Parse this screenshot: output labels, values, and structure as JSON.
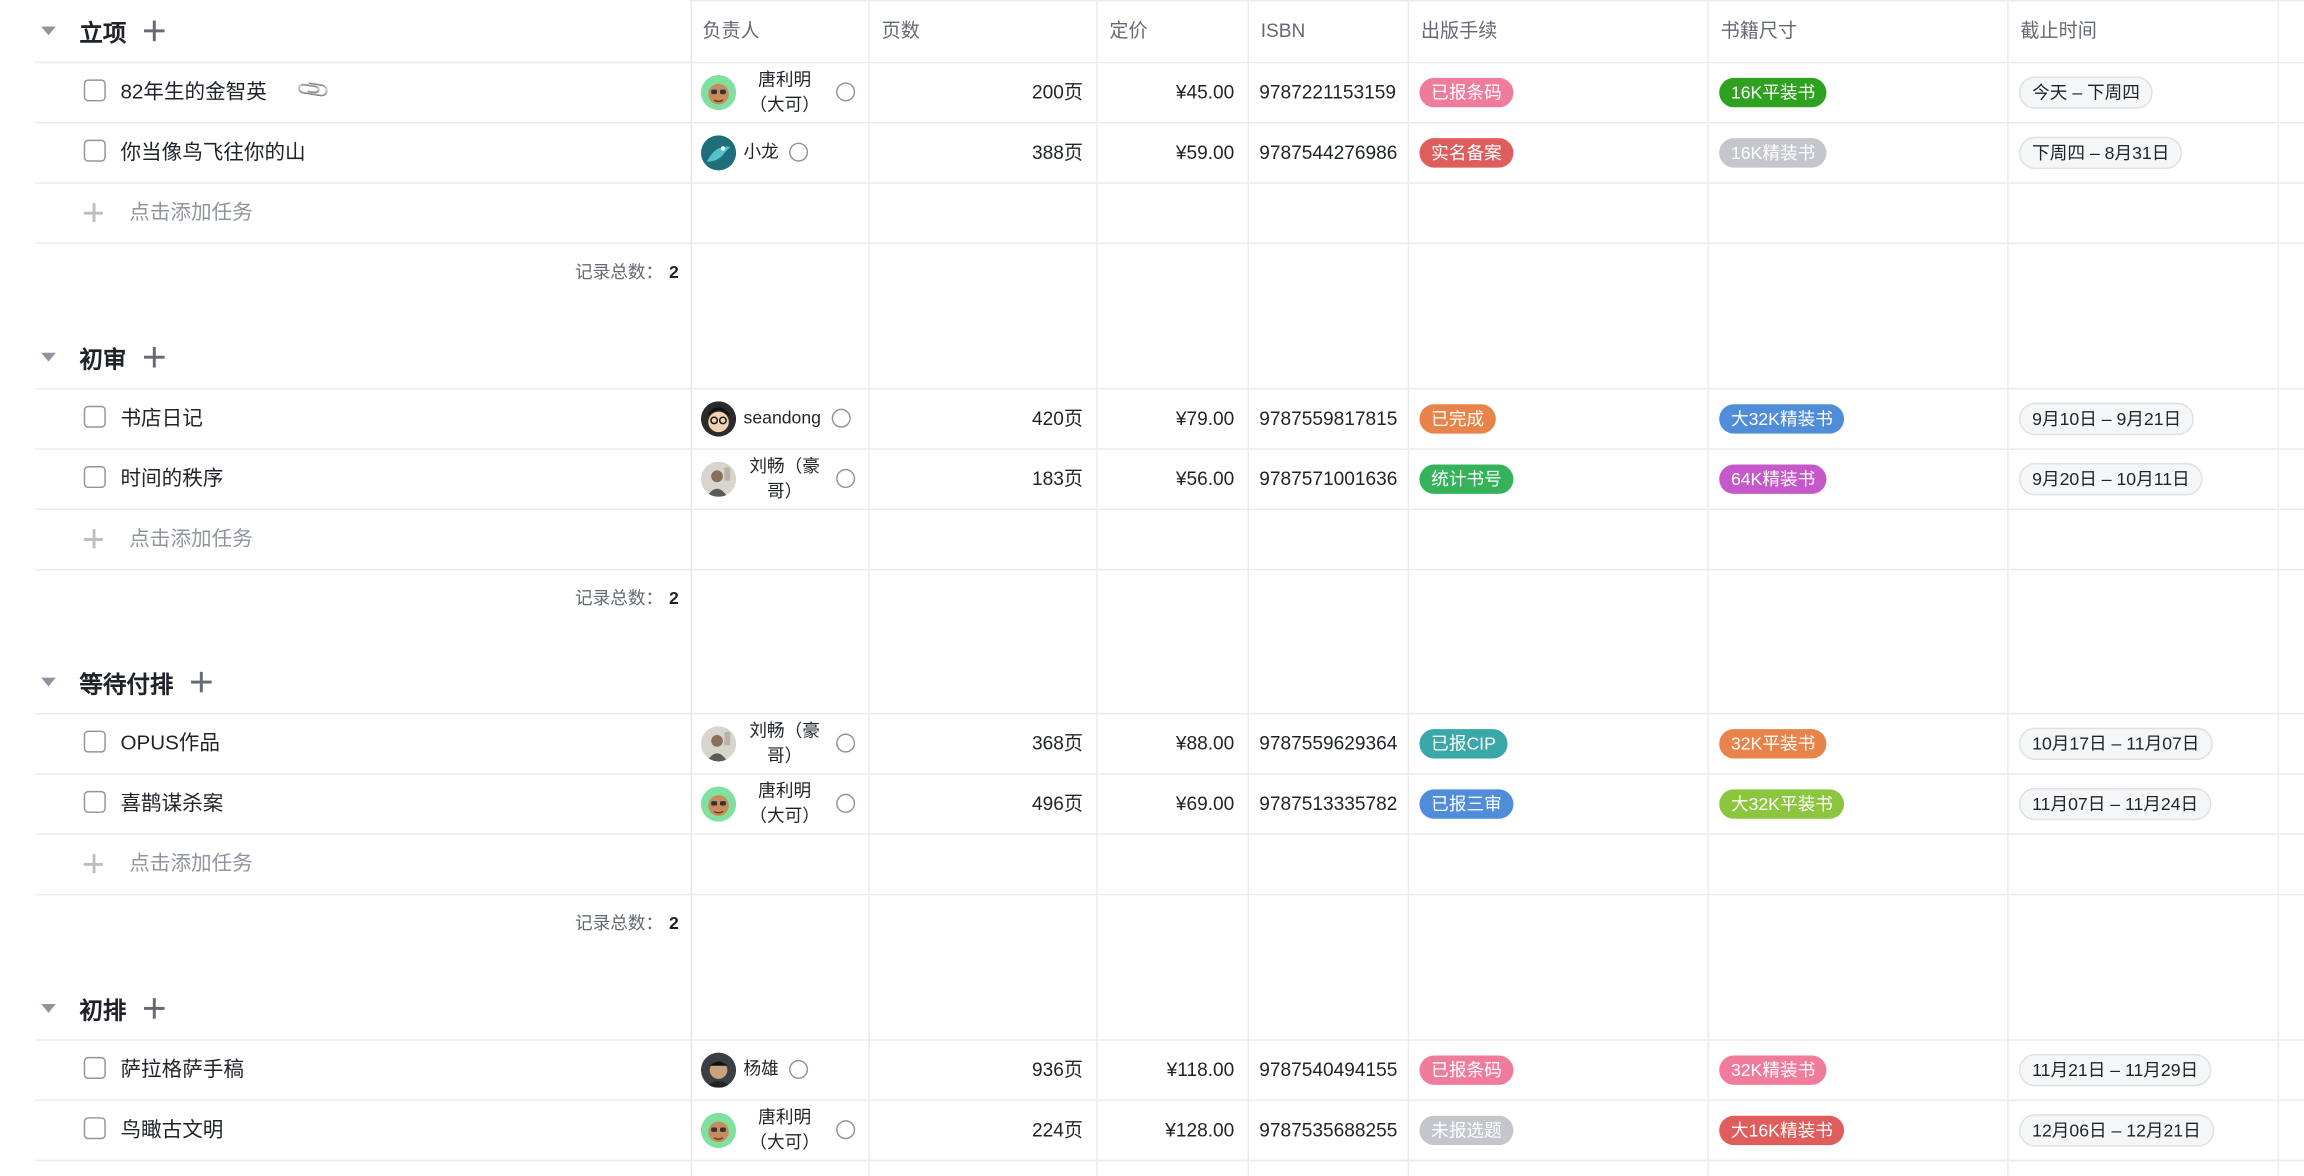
{
  "columns": {
    "owner": "负责人",
    "pages": "页数",
    "price": "定价",
    "isbn": "ISBN",
    "procedure": "出版手续",
    "size": "书籍尺寸",
    "deadline": "截止时间"
  },
  "add_task_label": "点击添加任务",
  "record_count_label": "记录总数：",
  "groups": [
    {
      "name": "立项",
      "count": "2",
      "tasks": [
        {
          "name": "82年生的金智英",
          "attachment": true,
          "owner": "唐利明（大可）",
          "owner_line1": "唐利明",
          "owner_line2": "（大可）",
          "avatar": "green-face",
          "pages": "200页",
          "price": "¥45.00",
          "isbn": "9787221153159",
          "procedure": "已报条码",
          "procedure_color": "#f07c9c",
          "size": "16K平装书",
          "size_color": "#2ea121",
          "deadline": "今天 – 下周四"
        },
        {
          "name": "你当像鸟飞往你的山",
          "owner": "小龙",
          "avatar": "teal-bird",
          "pages": "388页",
          "price": "¥59.00",
          "isbn": "9787544276986",
          "procedure": "实名备案",
          "procedure_color": "#e05d5d",
          "size": "16K精装书",
          "size_color": "#c4c6cc",
          "deadline": "下周四 – 8月31日"
        }
      ]
    },
    {
      "name": "初审",
      "count": "2",
      "tasks": [
        {
          "name": "书店日记",
          "owner": "seandong",
          "avatar": "dark-glasses",
          "pages": "420页",
          "price": "¥79.00",
          "isbn": "9787559817815",
          "procedure": "已完成",
          "procedure_color": "#e8844a",
          "size": "大32K精装书",
          "size_color": "#4f8ddb",
          "deadline": "9月10日 – 9月21日"
        },
        {
          "name": "时间的秩序",
          "owner": "刘畅（豪哥）",
          "owner_line1": "刘畅（豪",
          "owner_line2": "哥）",
          "avatar": "grey-man",
          "pages": "183页",
          "price": "¥56.00",
          "isbn": "9787571001636",
          "procedure": "统计书号",
          "procedure_color": "#34b35a",
          "size": "64K精装书",
          "size_color": "#c659c9",
          "deadline": "9月20日 – 10月11日"
        }
      ]
    },
    {
      "name": "等待付排",
      "count": "2",
      "tasks": [
        {
          "name": "OPUS作品",
          "owner": "刘畅（豪哥）",
          "owner_line1": "刘畅（豪",
          "owner_line2": "哥）",
          "avatar": "grey-man",
          "pages": "368页",
          "price": "¥88.00",
          "isbn": "9787559629364",
          "procedure": "已报CIP",
          "procedure_color": "#3aa8a8",
          "size": "32K平装书",
          "size_color": "#e8844a",
          "deadline": "10月17日 – 11月07日"
        },
        {
          "name": "喜鹊谋杀案",
          "owner": "唐利明（大可）",
          "owner_line1": "唐利明",
          "owner_line2": "（大可）",
          "avatar": "green-face",
          "pages": "496页",
          "price": "¥69.00",
          "isbn": "9787513335782",
          "procedure": "已报三审",
          "procedure_color": "#4f8ddb",
          "size": "大32K平装书",
          "size_color": "#8cc63f",
          "deadline": "11月07日 – 11月24日"
        }
      ]
    },
    {
      "name": "初排",
      "count": "",
      "tasks": [
        {
          "name": "萨拉格萨手稿",
          "owner": "杨雄",
          "avatar": "dark-man",
          "pages": "936页",
          "price": "¥118.00",
          "isbn": "9787540494155",
          "procedure": "已报条码",
          "procedure_color": "#f07c9c",
          "size": "32K精装书",
          "size_color": "#f07c9c",
          "deadline": "11月21日 – 11月29日"
        },
        {
          "name": "鸟瞰古文明",
          "owner": "唐利明（大可）",
          "owner_line1": "唐利明",
          "owner_line2": "（大可）",
          "avatar": "green-face",
          "pages": "224页",
          "price": "¥128.00",
          "isbn": "9787535688255",
          "procedure": "未报选题",
          "procedure_color": "#c4c6cc",
          "size": "大16K精装书",
          "size_color": "#e05d5d",
          "deadline": "12月06日 – 12月21日"
        }
      ]
    }
  ]
}
